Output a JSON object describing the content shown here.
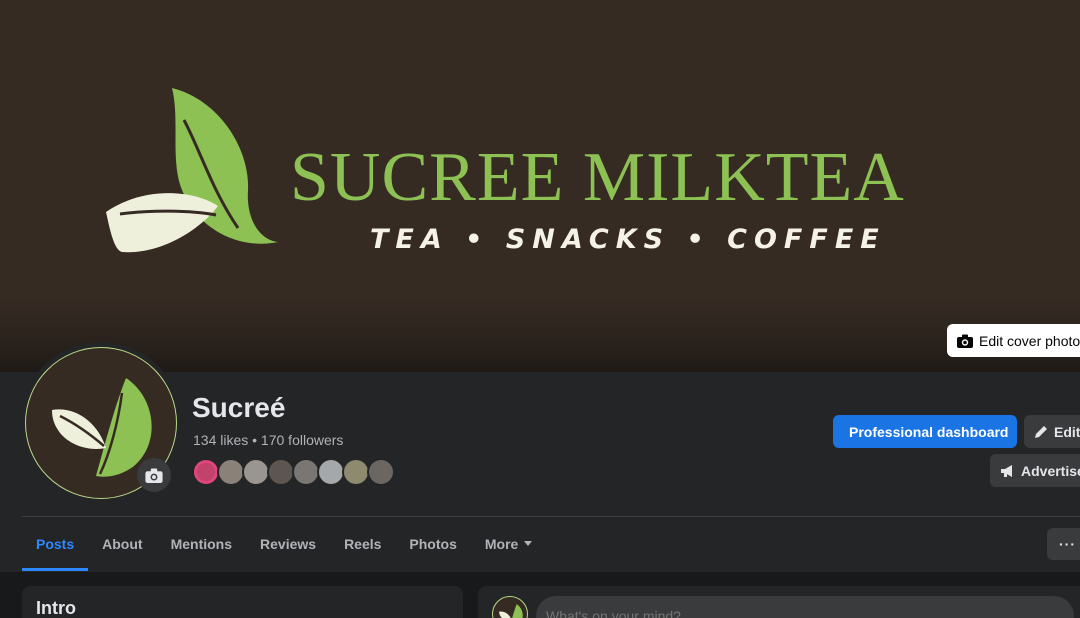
{
  "cover": {
    "brand_title": "SUCREE MILKTEA",
    "tagline": "TEA • SNACKS • COFFEE",
    "edit_cover_label": "Edit cover photo",
    "colors": {
      "background": "#352b23",
      "leaf_green": "#8dc153",
      "leaf_cream": "#eef0dc"
    }
  },
  "profile": {
    "name": "Sucreé",
    "stats": "134 likes • 170 followers",
    "follower_avatars": [
      "#c2426b",
      "#8a8178",
      "#9a9590",
      "#5d5650",
      "#7a7672",
      "#a5a8aa",
      "#8e8a6e",
      "#6b6662"
    ]
  },
  "actions": {
    "professional_dashboard": "Professional dashboard",
    "edit": "Edit",
    "advertise": "Advertise"
  },
  "tabs": [
    {
      "label": "Posts",
      "active": true
    },
    {
      "label": "About"
    },
    {
      "label": "Mentions"
    },
    {
      "label": "Reviews"
    },
    {
      "label": "Reels"
    },
    {
      "label": "Photos"
    },
    {
      "label": "More"
    }
  ],
  "more_options": "···",
  "intro": {
    "title": "Intro"
  },
  "composer": {
    "placeholder": "What's on your mind?"
  },
  "icons": {
    "camera": "camera-icon",
    "pencil": "pencil-icon",
    "megaphone": "megaphone-icon",
    "dashboard": "bar-chart-icon",
    "dropdown": "caret-down-icon"
  }
}
